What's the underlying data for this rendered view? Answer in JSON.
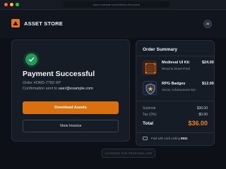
{
  "browser": {
    "url": "store.example.com/checkout/success"
  },
  "header": {
    "brand": "ASSET STORE",
    "avatar_initials": "JD"
  },
  "payment": {
    "title": "Payment Successful",
    "order_line": "Order #ORD-7782-XP",
    "confirmation_prefix": "Confirmation sent to ",
    "email": "user@example.com",
    "download_label": "Download Assets",
    "invoice_label": "View Invoice"
  },
  "summary": {
    "title": "Order Summary",
    "items": [
      {
        "name": "Medieval UI Kit",
        "subtitle": "Wood & Stone Pack",
        "price": "$24.00",
        "icon": "grid-tile-icon"
      },
      {
        "name": "RPG Badges",
        "subtitle": "Vector Achievement Set",
        "price": "$12.00",
        "icon": "shield-badge-icon"
      }
    ],
    "subtotal_label": "Subtotal",
    "subtotal_value": "$36.00",
    "tax_label": "Tax (0%)",
    "tax_value": "$0.00",
    "total_label": "Total",
    "total_value": "$36.00",
    "paid_prefix": "Paid with Card ending ",
    "card_last4": "8842"
  },
  "footer": {
    "license": "LICENSED FOR PERSONAL USE"
  },
  "colors": {
    "accent": "#d9700f",
    "success": "#1f9a5b",
    "background": "#0d1117"
  }
}
